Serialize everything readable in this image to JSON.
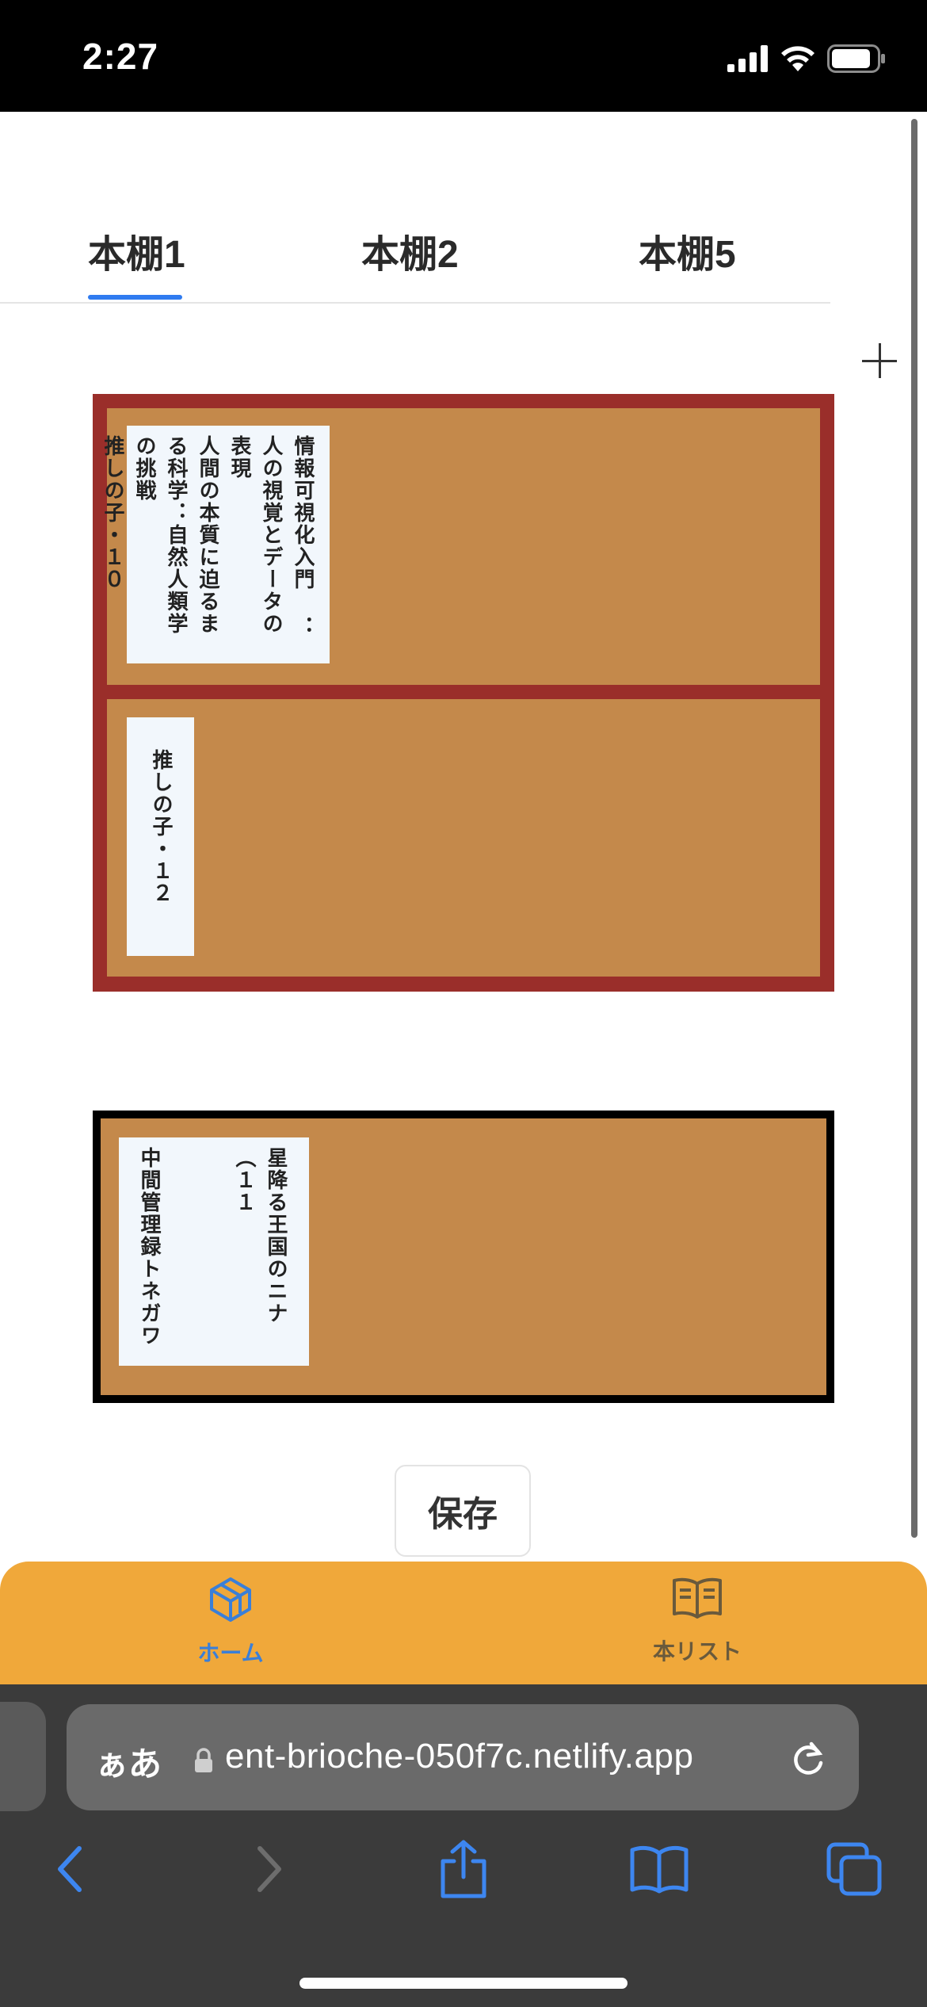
{
  "status_bar": {
    "time": "2:27"
  },
  "tabs": [
    {
      "label": "本棚1",
      "active": true
    },
    {
      "label": "本棚2",
      "active": false
    },
    {
      "label": "本棚5",
      "active": false
    }
  ],
  "shelves": [
    {
      "border_color": "#9a2e2a",
      "rows": [
        {
          "books": [
            "情報可視化入門 ：人の視覚とデータの表現",
            "人間の本質に迫るまる科学：自然人類学の挑戦",
            "推しの子・１０"
          ]
        },
        {
          "books": [
            "推しの子・１２"
          ]
        }
      ]
    },
    {
      "border_color": "#000000",
      "rows": [
        {
          "books": [
            "星降る王国のニナ（１１",
            "中間管理録トネガワ"
          ]
        }
      ]
    }
  ],
  "save_label": "保存",
  "nav": {
    "home_label": "ホーム",
    "booklist_label": "本リスト",
    "active_color": "#3a7fd8",
    "inactive_color": "#6a5a3c"
  },
  "browser": {
    "aa_label": "ぁあ",
    "url": "ent-brioche-050f7c.netlify.app"
  },
  "colors": {
    "shelf_wood": "#c4894b",
    "book_paper": "#f2f7fc",
    "nav_bg": "#f0a83a",
    "accent": "#2f7bf0"
  }
}
